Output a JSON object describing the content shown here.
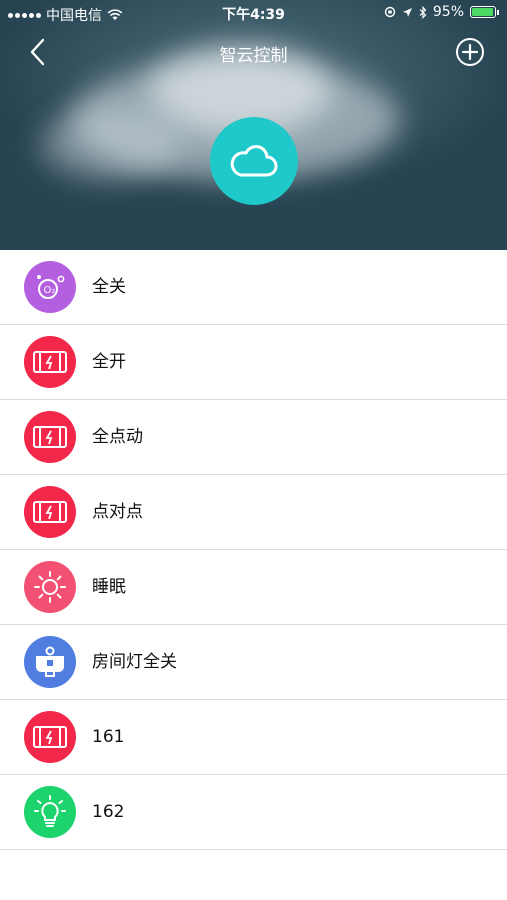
{
  "status_bar": {
    "carrier": "中国电信",
    "time": "下午4:39",
    "battery": "95%"
  },
  "nav": {
    "title": "智云控制"
  },
  "scenes": [
    {
      "label": "全关",
      "icon": "oxygen-icon",
      "color": "#b45ee0"
    },
    {
      "label": "全开",
      "icon": "curtain-icon",
      "color": "#f2274a"
    },
    {
      "label": "全点动",
      "icon": "curtain-icon",
      "color": "#f2274a"
    },
    {
      "label": "点对点",
      "icon": "curtain-icon",
      "color": "#f2274a"
    },
    {
      "label": "睡眠",
      "icon": "sun-icon",
      "color": "#f25173"
    },
    {
      "label": "房间灯全关",
      "icon": "lamp-icon",
      "color": "#4f7de0"
    },
    {
      "label": "161",
      "icon": "curtain-icon",
      "color": "#f2274a"
    },
    {
      "label": "162",
      "icon": "bulb-icon",
      "color": "#1dd36b"
    }
  ],
  "colors": {
    "accent_cloud": "#1fc8c9"
  }
}
